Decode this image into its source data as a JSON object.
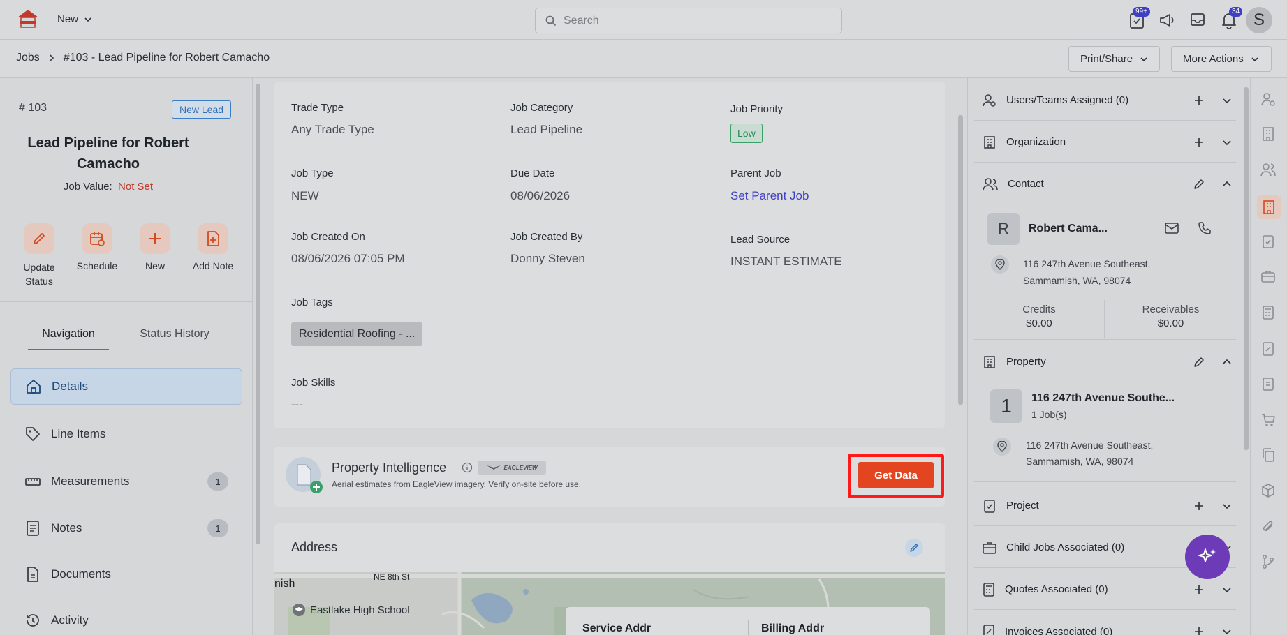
{
  "topbar": {
    "new_label": "New",
    "search_placeholder": "Search",
    "tasks_badge": "99+",
    "notifications_badge": "34",
    "avatar_initial": "S"
  },
  "breadcrumb": {
    "root": "Jobs",
    "current": "#103 - Lead Pipeline for Robert Camacho"
  },
  "header_actions": {
    "print_share": "Print/Share",
    "more_actions": "More Actions"
  },
  "job": {
    "number": "# 103",
    "status_badge": "New Lead",
    "title": "Lead Pipeline for Robert Camacho",
    "value_label": "Job Value:",
    "value": "Not Set"
  },
  "quick_actions": [
    {
      "label": "Update Status",
      "icon": "pencil-icon"
    },
    {
      "label": "Schedule",
      "icon": "calendar-icon"
    },
    {
      "label": "New",
      "icon": "plus-icon"
    },
    {
      "label": "Add Note",
      "icon": "note-add-icon"
    }
  ],
  "left_tabs": {
    "navigation": "Navigation",
    "status_history": "Status History"
  },
  "nav_items": [
    {
      "label": "Details",
      "icon": "home-icon",
      "active": true,
      "count": ""
    },
    {
      "label": "Line Items",
      "icon": "tag-icon",
      "count": ""
    },
    {
      "label": "Measurements",
      "icon": "ruler-icon",
      "count": "1"
    },
    {
      "label": "Notes",
      "icon": "notes-icon",
      "count": "1"
    },
    {
      "label": "Documents",
      "icon": "document-icon",
      "count": ""
    },
    {
      "label": "Activity",
      "icon": "history-icon",
      "count": ""
    }
  ],
  "details": {
    "trade_type": {
      "label": "Trade Type",
      "value": "Any Trade Type"
    },
    "job_category": {
      "label": "Job Category",
      "value": "Lead Pipeline"
    },
    "job_priority": {
      "label": "Job Priority",
      "value": "Low"
    },
    "job_type": {
      "label": "Job Type",
      "value": "NEW"
    },
    "due_date": {
      "label": "Due Date",
      "value": "08/06/2026"
    },
    "parent_job": {
      "label": "Parent Job",
      "value": "Set Parent Job"
    },
    "created_on": {
      "label": "Job Created On",
      "value": "08/06/2026 07:05 PM"
    },
    "created_by": {
      "label": "Job Created By",
      "value": "Donny Steven"
    },
    "lead_source": {
      "label": "Lead Source",
      "value": "INSTANT ESTIMATE"
    },
    "tags": {
      "label": "Job Tags",
      "value": "Residential Roofing - ..."
    },
    "skills": {
      "label": "Job Skills",
      "value": "---"
    }
  },
  "property_intelligence": {
    "title": "Property Intelligence",
    "provider": "EAGLEVIEW",
    "subtitle": "Aerial estimates from EagleView imagery. Verify on-site before use.",
    "button": "Get Data"
  },
  "address_card": {
    "title": "Address",
    "map_labels": {
      "street": "NE 8th St",
      "city_fragment": "nish",
      "school": "Eastlake High School"
    },
    "service_address": "Service Addr",
    "billing_address": "Billing Addr"
  },
  "right_panel": {
    "users_teams": "Users/Teams Assigned (0)",
    "organization": "Organization",
    "contact": {
      "title": "Contact",
      "initial": "R",
      "name": "Robert Cama...",
      "address_line1": "116 247th Avenue Southeast,",
      "address_line2": "Sammamish, WA, 98074",
      "credits_label": "Credits",
      "credits_value": "$0.00",
      "receivables_label": "Receivables",
      "receivables_value": "$0.00"
    },
    "property": {
      "title": "Property",
      "number": "1",
      "name": "116 247th Avenue Southe...",
      "jobs": "1 Job(s)",
      "address_line1": "116 247th Avenue Southeast,",
      "address_line2": "Sammamish, WA, 98074"
    },
    "project": "Project",
    "child_jobs": "Child Jobs Associated (0)",
    "quotes": "Quotes Associated (0)",
    "invoices": "Invoices Associated (0)"
  },
  "colors": {
    "accent_orange": "#e2451f",
    "highlight_red": "#ff1a1a",
    "link_blue": "#3f3fc4",
    "fab_purple": "#6d3ab8"
  }
}
